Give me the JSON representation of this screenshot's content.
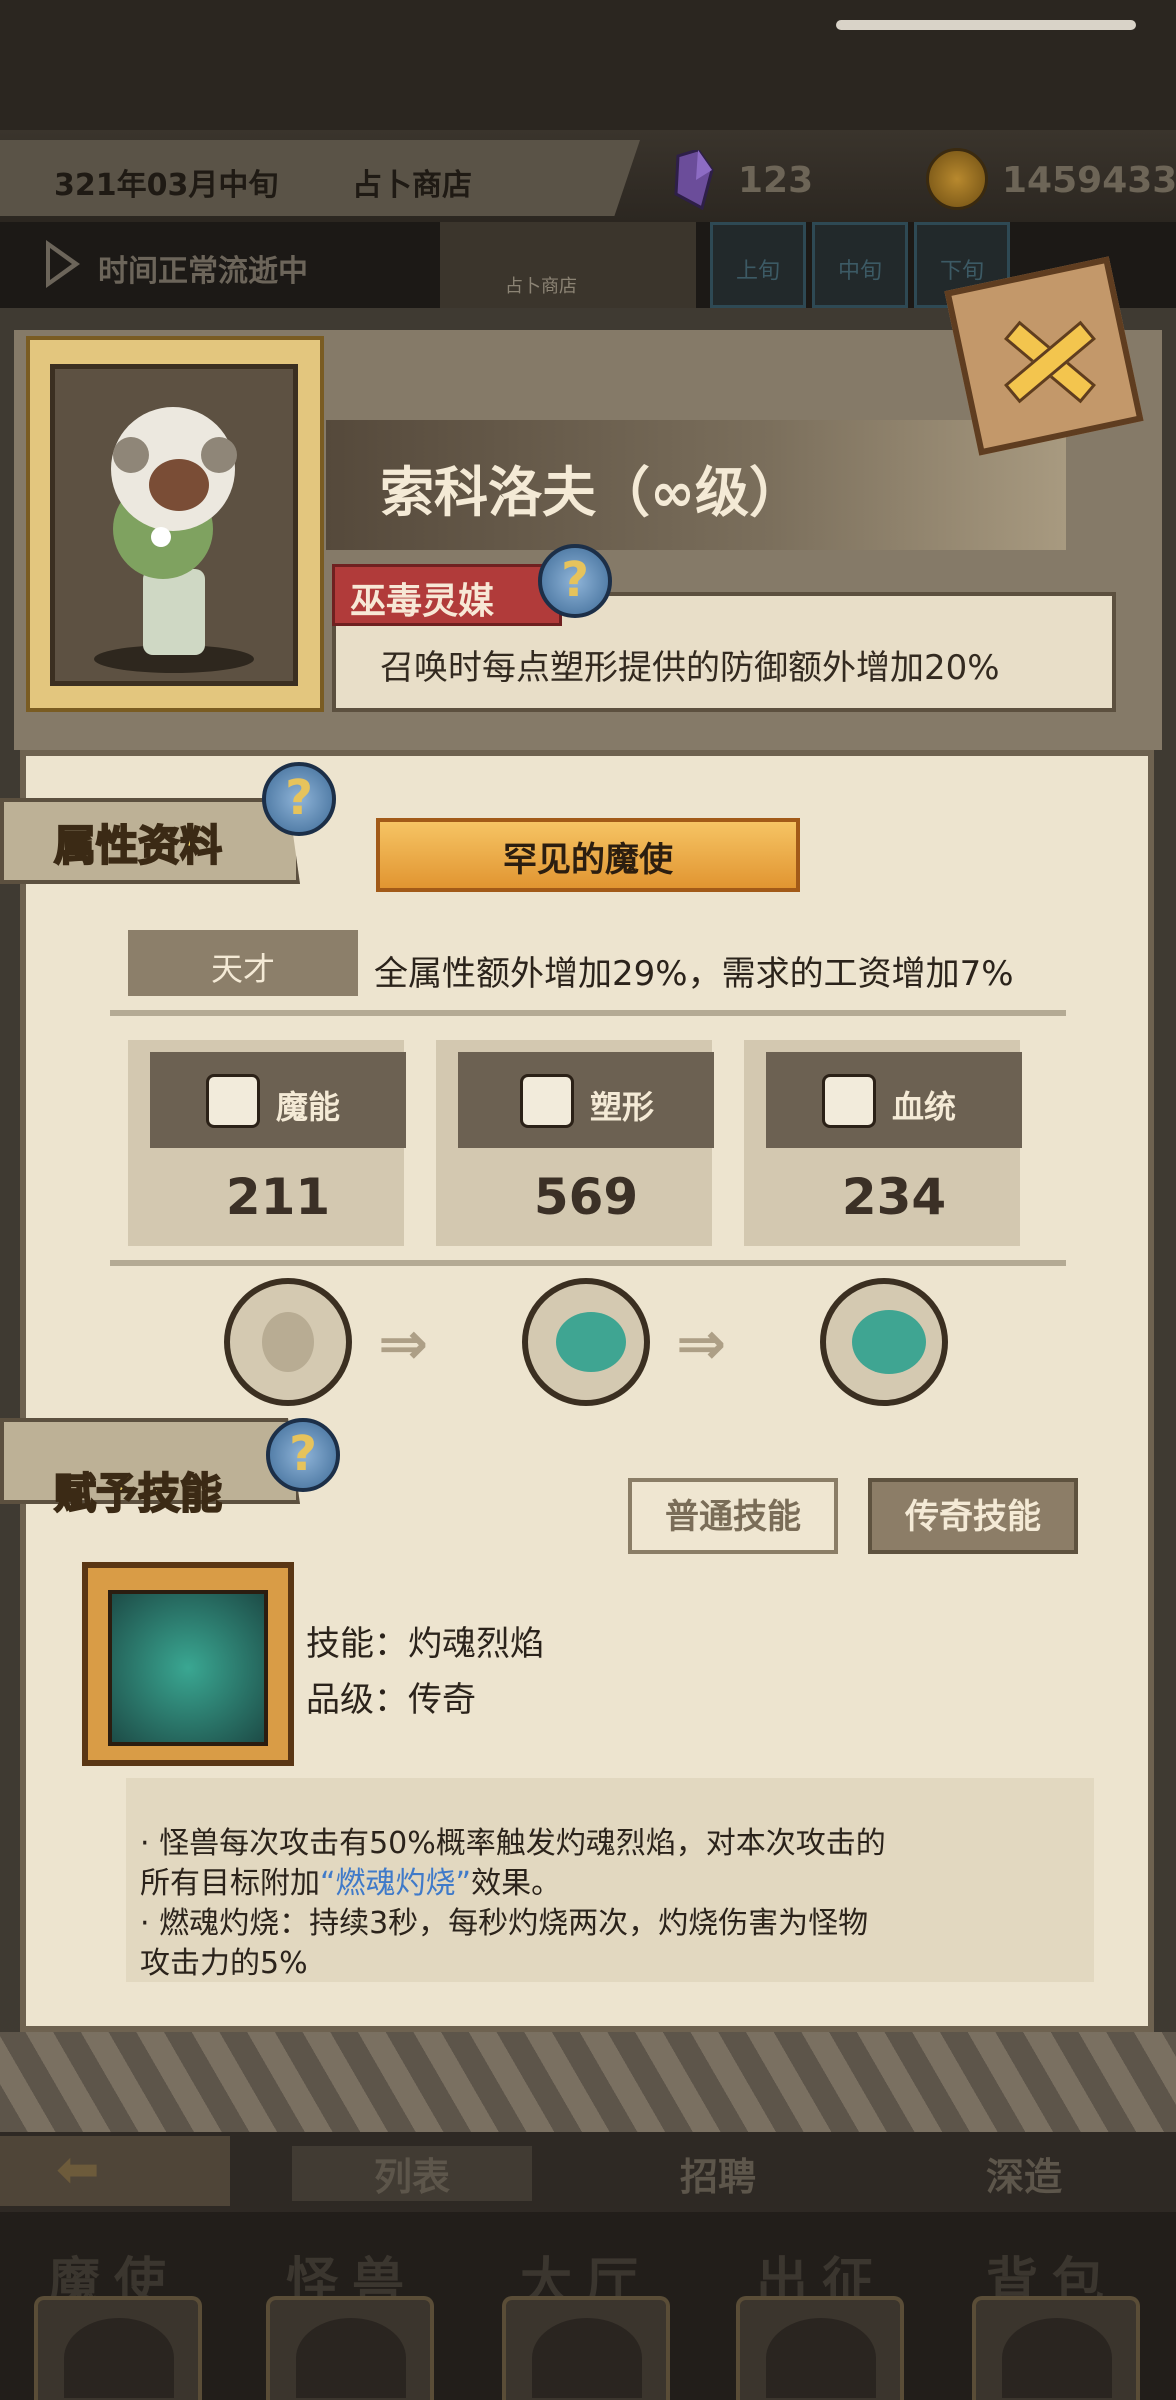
{
  "status_bar": {
    "date": "321年03月中旬",
    "location": "占卜商店",
    "crystal_count": "123",
    "coin_count": "1459433",
    "time_status": "时间正常流逝中",
    "mini_location": "占卜商店",
    "time_slots": [
      "上旬",
      "中旬",
      "下旬"
    ]
  },
  "hero": {
    "name": "索科洛夫（∞级）",
    "class_tag": "巫毒灵媒",
    "trait_text": "召唤时每点塑形提供的防御额外增加20%"
  },
  "attributes": {
    "section_title": "属性资料",
    "rarity": "罕见的魔使",
    "talent_label": "天才",
    "talent_text": "全属性额外增加29%，需求的工资增加7%",
    "stats": [
      {
        "name": "魔能",
        "value": "211",
        "icon": "demon-energy-icon"
      },
      {
        "name": "塑形",
        "value": "569",
        "icon": "shaping-body-icon"
      },
      {
        "name": "血统",
        "value": "234",
        "icon": "bloodline-gear-icon"
      }
    ]
  },
  "skills": {
    "section_title": "赋予技能",
    "tab_normal": "普通技能",
    "tab_legend": "传奇技能",
    "skill_name_line": "技能：灼魂烈焰",
    "skill_grade_line": "品级：传奇",
    "desc_line1": "·   怪兽每次攻击有50%概率触发灼魂烈焰，对本次攻击的",
    "desc_line2_pre": "所有目标附加",
    "desc_line2_hl": "“燃魂灼烧”",
    "desc_line2_post": "效果。",
    "desc_line3": "·   燃魂灼烧：持续3秒，每秒灼烧两次，灼烧伤害为怪物",
    "desc_line4": "攻击力的5%"
  },
  "sub_nav": [
    "列表",
    "招聘",
    "深造"
  ],
  "main_nav": [
    "魔使",
    "怪兽",
    "大厅",
    "出征",
    "背包"
  ],
  "colors": {
    "accent_orange": "#e19531",
    "highlight_blue": "#3f7ac9",
    "class_red": "#b13b3a",
    "help_blue": "#3d6a96"
  }
}
